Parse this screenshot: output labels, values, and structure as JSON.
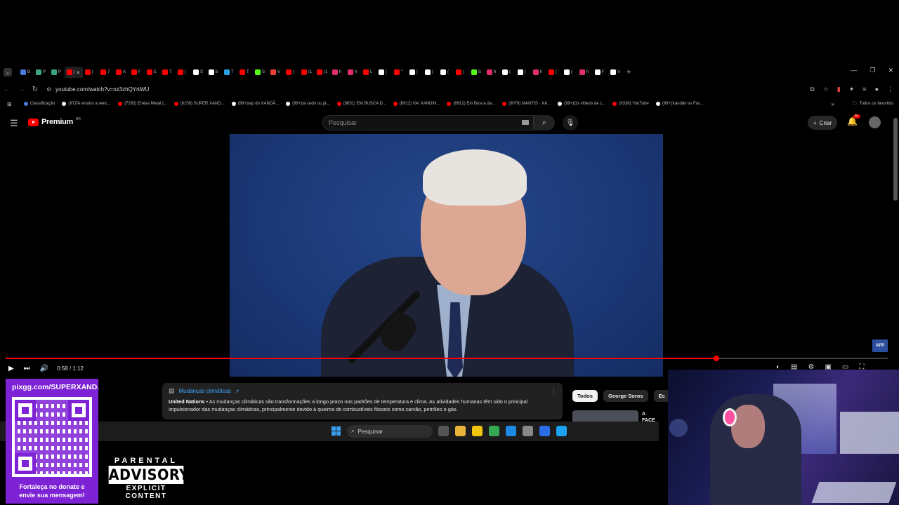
{
  "browser": {
    "tabs": [
      {
        "label": "B",
        "color": "#4a7bd8"
      },
      {
        "label": "P",
        "color": "#3ba87b"
      },
      {
        "label": "P",
        "color": "#3ba87b"
      },
      {
        "label": "(",
        "color": "#ff0000",
        "active": true
      },
      {
        "label": "(",
        "color": "#ff0000"
      },
      {
        "label": "7",
        "color": "#ff0000"
      },
      {
        "label": "A",
        "color": "#ff0000"
      },
      {
        "label": "F",
        "color": "#ff0000"
      },
      {
        "label": "E",
        "color": "#ff0000"
      },
      {
        "label": "T",
        "color": "#ff0000"
      },
      {
        "label": "(",
        "color": "#ff0000"
      },
      {
        "label": "S",
        "color": "#ffffff"
      },
      {
        "label": "b",
        "color": "#ffffff"
      },
      {
        "label": "T",
        "color": "#2aa3e0"
      },
      {
        "label": "T",
        "color": "#ff0000"
      },
      {
        "label": "S",
        "color": "#53fc18"
      },
      {
        "label": "V",
        "color": "#ea4335"
      },
      {
        "label": "(",
        "color": "#ff0000"
      },
      {
        "label": "(1",
        "color": "#ff0000"
      },
      {
        "label": "(1",
        "color": "#ff0000"
      },
      {
        "label": "h",
        "color": "#e1306c"
      },
      {
        "label": "h",
        "color": "#e1306c"
      },
      {
        "label": "L",
        "color": "#ff0000"
      },
      {
        "label": "(",
        "color": "#ffffff"
      },
      {
        "label": "\"",
        "color": "#ff0000"
      },
      {
        "label": "(",
        "color": "#ffffff"
      },
      {
        "label": "(",
        "color": "#ffffff"
      },
      {
        "label": "(",
        "color": "#ffffff"
      },
      {
        "label": "(",
        "color": "#ff0000"
      },
      {
        "label": "S",
        "color": "#53fc18"
      },
      {
        "label": "h",
        "color": "#e1306c"
      },
      {
        "label": "(",
        "color": "#ffffff"
      },
      {
        "label": "(",
        "color": "#ffffff"
      },
      {
        "label": "h",
        "color": "#e1306c"
      },
      {
        "label": "(",
        "color": "#ff0000"
      },
      {
        "label": "(",
        "color": "#ffffff"
      },
      {
        "label": "h",
        "color": "#e1306c"
      },
      {
        "label": "F",
        "color": "#ffffff"
      },
      {
        "label": "V",
        "color": "#ffffff"
      }
    ],
    "close_glyph": "×",
    "new_tab_glyph": "+",
    "window_controls": [
      "—",
      "❐",
      "✕"
    ],
    "url": "youtube.com/watch?v=nz3zhQYrtWU",
    "bookmarks": [
      {
        "label": "Classificação",
        "color": "#4a7bd8"
      },
      {
        "label": "(97)Te ensino a venc...",
        "color": "#ffffff"
      },
      {
        "label": "(7292) Enéas Metal |...",
        "color": "#ff0000"
      },
      {
        "label": "(8159) SUPER XAND...",
        "color": "#ff0000"
      },
      {
        "label": "(99+)rap do XANDÃ...",
        "color": "#ffffff"
      },
      {
        "label": "(99+)tá cedo ou já...",
        "color": "#ffffff"
      },
      {
        "label": "(8851) EM BUSCA D...",
        "color": "#ff0000"
      },
      {
        "label": "(8912) VAI XANDIN...",
        "color": "#ff0000"
      },
      {
        "label": "(8912) Em Busca da...",
        "color": "#ff0000"
      },
      {
        "label": "(9078) MANTIS · XA...",
        "color": "#ff0000"
      },
      {
        "label": "(99+)Os vídeos de c...",
        "color": "#ffffff"
      },
      {
        "label": "(9338) YouTube",
        "color": "#ff0000"
      },
      {
        "label": "(99+)Xandão vs Fra...",
        "color": "#ffffff"
      }
    ],
    "all_bookmarks": "Todos os favoritos"
  },
  "youtube": {
    "logo_word": "Premium",
    "logo_region": "BR",
    "search_placeholder": "Pesquisar",
    "create_label": "Criar",
    "notif_count": "9+",
    "afp_label": "AFP",
    "time": "0:58 / 1:12",
    "progress": 0.806,
    "info_card": {
      "title": "Mudanças climáticas",
      "source": "United Nations",
      "text": " • As mudanças climáticas são transformações a longo prazo nos padrões de temperatura e clima. As atividades humanas têm sido o principal impulsionador das mudanças climáticas, principalmente devido à queima de combustíveis fósseis como carvão, petróleo e gás."
    },
    "chips": [
      "Todos",
      "George Soros",
      "Ec"
    ],
    "rec_title": "A FACE DOS..."
  },
  "taskbar": {
    "search_placeholder": "Pesquisar",
    "icons": [
      "#555555",
      "#e8b339",
      "#f1c40f",
      "#34a853",
      "#1e88e5",
      "#888888",
      "#2b6de6",
      "#1da1f2"
    ]
  },
  "overlay": {
    "qr_url": "pixgg.com/SUPERXANDA",
    "qr_msg_line1": "Fortaleça no donate e",
    "qr_msg_line2": "envie sua mensagem!",
    "pa_top": "PARENTAL",
    "pa_mid": "ADVISORY",
    "pa_bot": "EXPLICIT CONTENT"
  }
}
